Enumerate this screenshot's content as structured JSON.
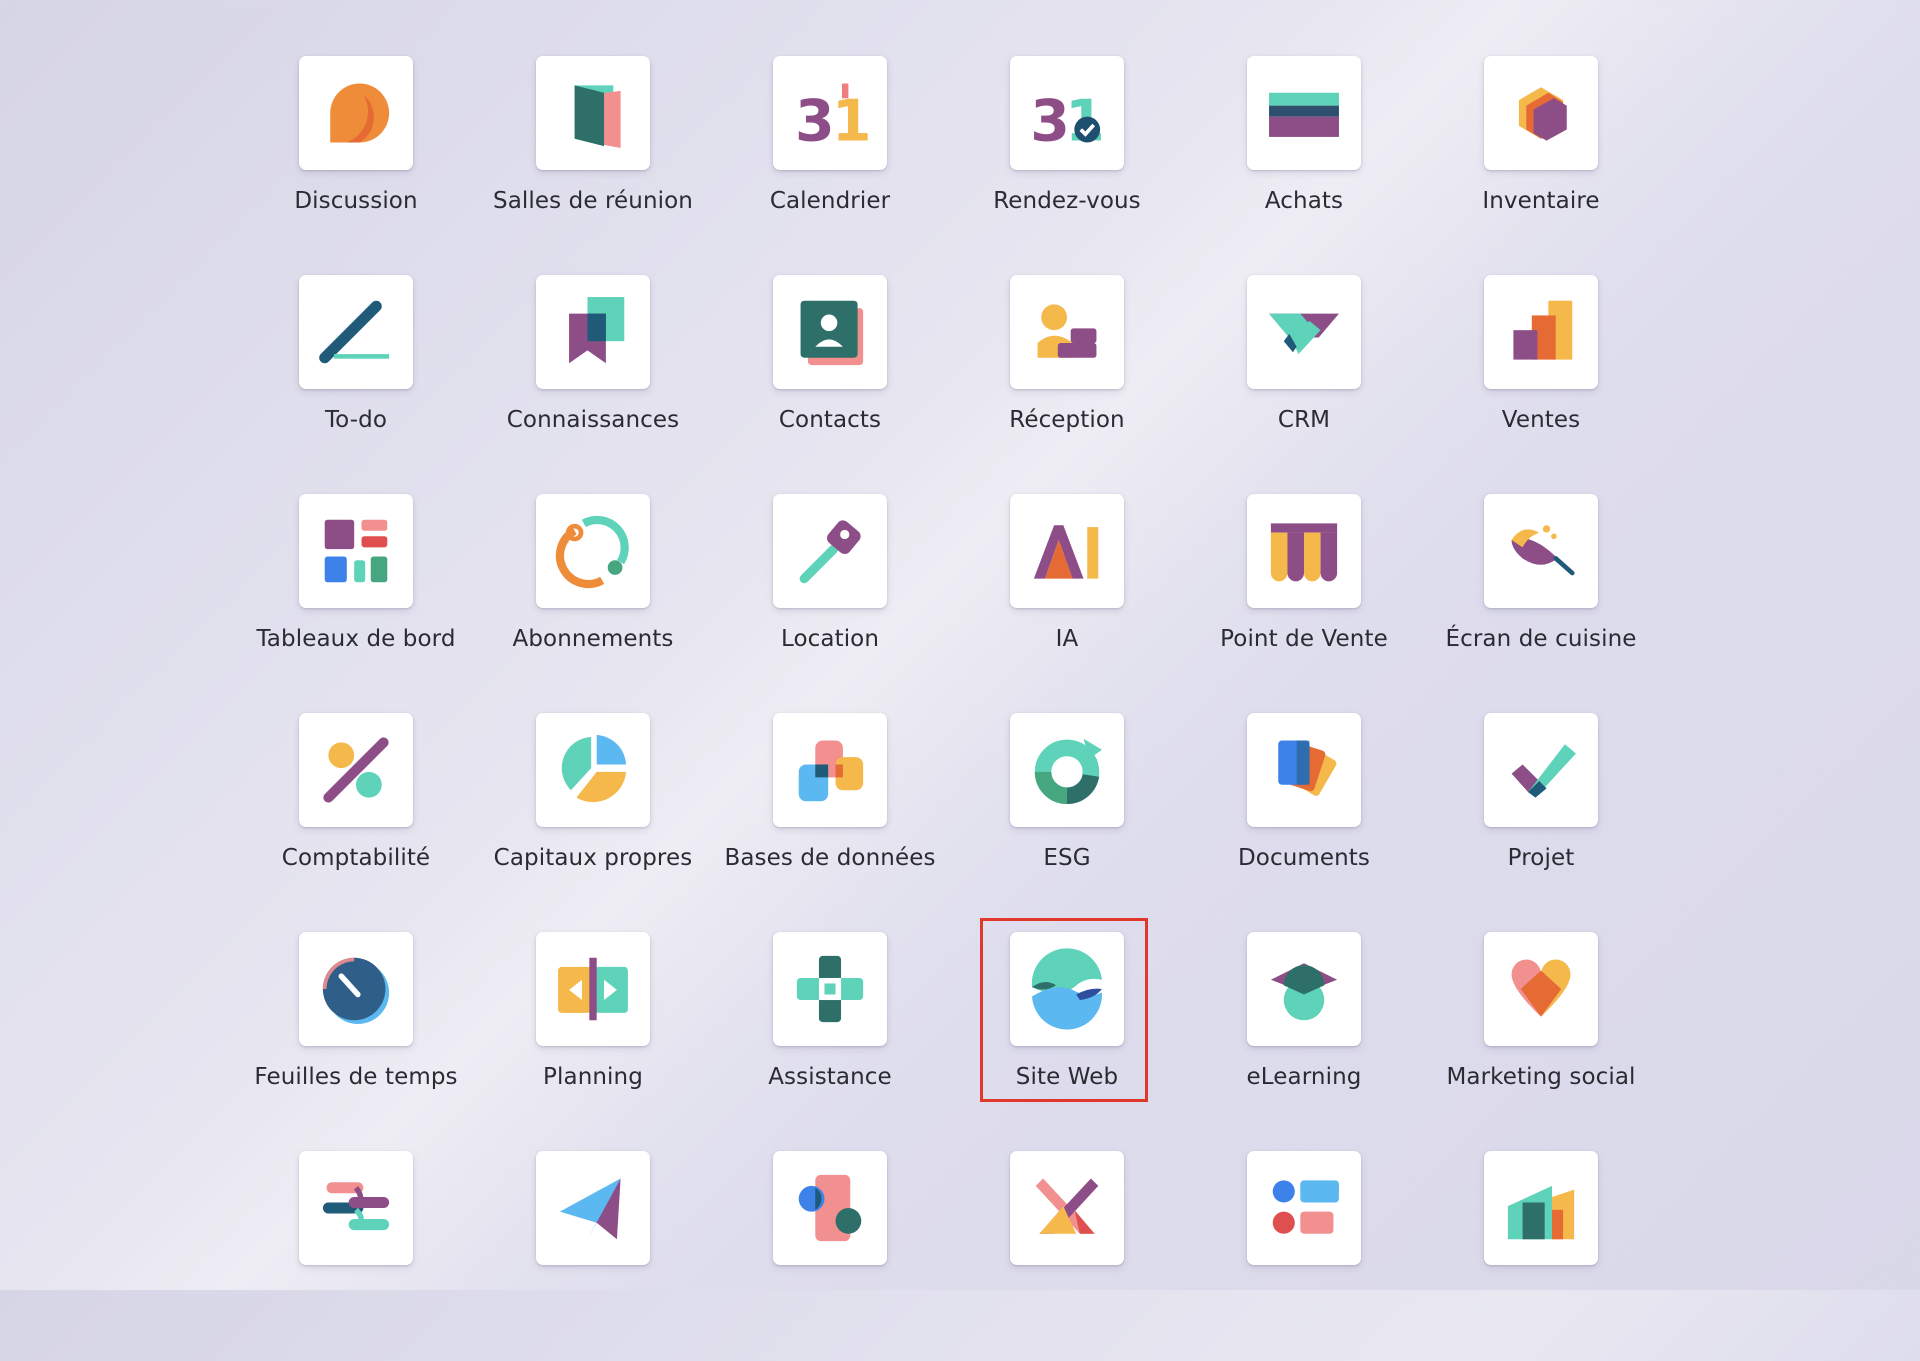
{
  "apps": [
    {
      "label": "Discussion",
      "icon": "discussion-icon"
    },
    {
      "label": "Salles de réunion",
      "icon": "meeting-rooms-icon"
    },
    {
      "label": "Calendrier",
      "icon": "calendar-icon"
    },
    {
      "label": "Rendez-vous",
      "icon": "appointments-icon"
    },
    {
      "label": "Achats",
      "icon": "purchase-icon"
    },
    {
      "label": "Inventaire",
      "icon": "inventory-icon"
    },
    {
      "label": "To-do",
      "icon": "todo-icon"
    },
    {
      "label": "Connaissances",
      "icon": "knowledge-icon"
    },
    {
      "label": "Contacts",
      "icon": "contacts-icon"
    },
    {
      "label": "Réception",
      "icon": "reception-icon"
    },
    {
      "label": "CRM",
      "icon": "crm-icon"
    },
    {
      "label": "Ventes",
      "icon": "sales-icon"
    },
    {
      "label": "Tableaux de bord",
      "icon": "dashboards-icon"
    },
    {
      "label": "Abonnements",
      "icon": "subscriptions-icon"
    },
    {
      "label": "Location",
      "icon": "rental-icon"
    },
    {
      "label": "IA",
      "icon": "ai-icon"
    },
    {
      "label": "Point de Vente",
      "icon": "point-of-sale-icon"
    },
    {
      "label": "Écran de cuisine",
      "icon": "kitchen-display-icon"
    },
    {
      "label": "Comptabilité",
      "icon": "accounting-icon"
    },
    {
      "label": "Capitaux propres",
      "icon": "equity-icon"
    },
    {
      "label": "Bases de données",
      "icon": "databases-icon"
    },
    {
      "label": "ESG",
      "icon": "esg-icon"
    },
    {
      "label": "Documents",
      "icon": "documents-icon"
    },
    {
      "label": "Projet",
      "icon": "project-icon"
    },
    {
      "label": "Feuilles de temps",
      "icon": "timesheets-icon"
    },
    {
      "label": "Planning",
      "icon": "planning-icon"
    },
    {
      "label": "Assistance",
      "icon": "helpdesk-icon"
    },
    {
      "label": "Site Web",
      "icon": "website-icon"
    },
    {
      "label": "eLearning",
      "icon": "elearning-icon"
    },
    {
      "label": "Marketing social",
      "icon": "social-marketing-icon"
    },
    {
      "label": "",
      "icon": "studio-connect-icon"
    },
    {
      "label": "",
      "icon": "email-marketing-icon"
    },
    {
      "label": "",
      "icon": "shapes-icon"
    },
    {
      "label": "",
      "icon": "events-icon"
    },
    {
      "label": "",
      "icon": "surveys-icon"
    },
    {
      "label": "",
      "icon": "analytics-icon"
    }
  ],
  "selected_app": "Site Web",
  "colors": {
    "highlight": "#e0392b",
    "tile": "#ffffff"
  }
}
